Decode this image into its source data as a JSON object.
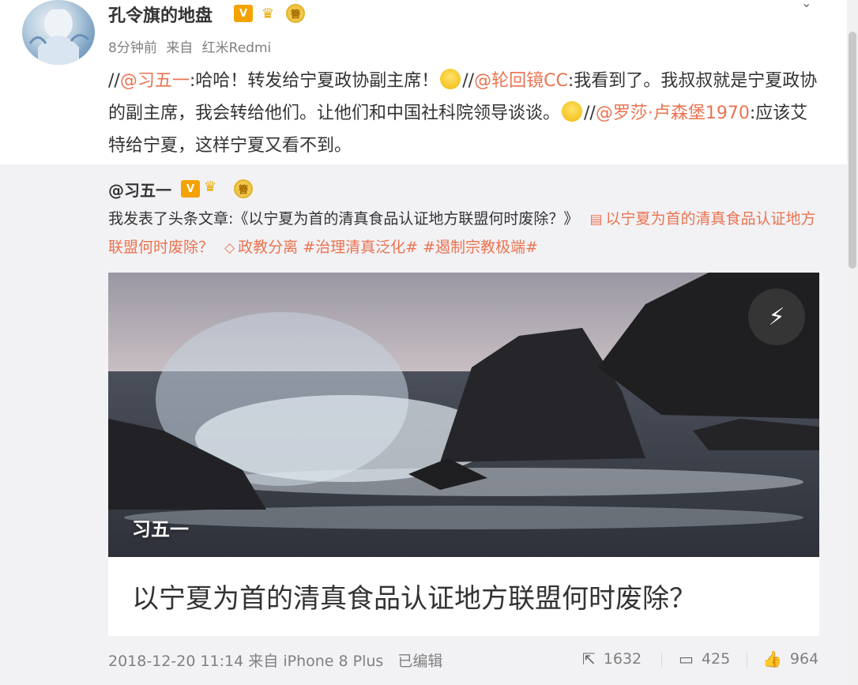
{
  "post": {
    "author": "孔令旗的地盘",
    "badge_v": "V",
    "badge_coin": "簪",
    "time": "8分钟前",
    "source_prefix": "来自",
    "source": "红米Redmi",
    "text": {
      "p1": "//",
      "m1": "@习五一",
      "p2": ":哈哈！转发给宁夏政协副主席！",
      "p3": "//",
      "m2": "@轮回镜CC",
      "p4": ":我看到了。我叔叔就是宁夏政协的副主席，我会转给他们。让他们和中国社科院领导谈谈。",
      "p5": "//",
      "m3": "@罗莎·卢森堡1970",
      "p6": ":应该艾特给宁夏，这样宁夏又看不到。"
    }
  },
  "repost": {
    "author": "@习五一",
    "badge_v": "V",
    "badge_coin": "簪",
    "intro": "我发表了头条文章:《以宁夏为首的清真食品认证地方联盟何时废除？》",
    "article_link": "以宁夏为首的清真食品认证地方联盟何时废除？",
    "tag_topic": "政教分离",
    "hashtag1": "#治理清真泛化#",
    "hashtag2": "#遏制宗教极端#",
    "card": {
      "cover_author": "习五一",
      "title": "以宁夏为首的清真食品认证地方联盟何时废除？"
    },
    "footer": {
      "time": "2018-12-20 11:14",
      "source_prefix": "来自",
      "source": "iPhone 8 Plus",
      "edited": "已编辑",
      "forward_count": "1632",
      "comment_count": "425",
      "like_count": "964"
    }
  },
  "icons": [
    "chevron-down-icon",
    "doc-icon",
    "tag-icon",
    "flash-icon",
    "forward-icon",
    "comment-icon",
    "like-icon"
  ],
  "colors": {
    "link": "#eb7350",
    "badge": "#f4a200",
    "repost_bg": "#f2f2f5"
  }
}
